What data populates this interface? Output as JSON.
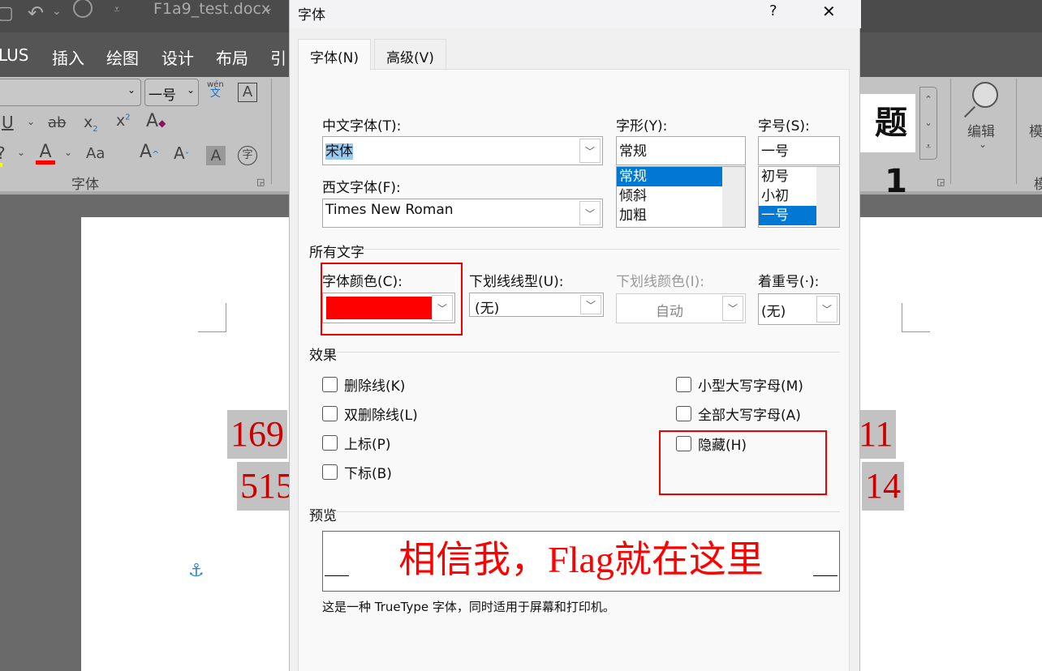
{
  "titlebar": {
    "filename": "F1a9_test.docx",
    "icons": [
      "save-icon",
      "undo-icon",
      "redo-icon",
      "customize-icon"
    ]
  },
  "menu": {
    "items": [
      "LUS",
      "插入",
      "绘图",
      "设计",
      "布局",
      "引"
    ]
  },
  "ribbon": {
    "font_size_value": "一号",
    "group_label": "字体",
    "style_preview": "题 1",
    "edit_label": "编辑",
    "partial_label": "模",
    "partial_label2": "模",
    "phonetic_top": "wén",
    "phonetic_bottom": "文",
    "char_border": "A",
    "circle_char": "字",
    "aa_label": "Aa"
  },
  "document": {
    "line1_left": "169",
    "line2_left": "515",
    "line1_right": "11",
    "line2_right": "14",
    "text_color": "#cc0000"
  },
  "dialog": {
    "title": "字体",
    "help": "?",
    "close": "✕",
    "tabs": [
      {
        "label": "字体(N)",
        "active": true
      },
      {
        "label": "高级(V)",
        "active": false
      }
    ],
    "chinese_font": {
      "label": "中文字体(T):",
      "value": "宋体"
    },
    "western_font": {
      "label": "西文字体(F):",
      "value": "Times New Roman"
    },
    "style": {
      "label": "字形(Y):",
      "value": "常规",
      "options": [
        "常规",
        "倾斜",
        "加粗"
      ],
      "selected": "常规"
    },
    "size": {
      "label": "字号(S):",
      "value": "一号",
      "options": [
        "初号",
        "小初",
        "一号"
      ],
      "selected": "一号"
    },
    "all_text": {
      "label": "所有文字",
      "font_color": {
        "label": "字体颜色(C):",
        "value": "#ff0000"
      },
      "underline_style": {
        "label": "下划线线型(U):",
        "value": "(无)"
      },
      "underline_color": {
        "label": "下划线颜色(I):",
        "value": "自动",
        "disabled": true
      },
      "emphasis": {
        "label": "着重号(·):",
        "value": "(无)"
      }
    },
    "effects": {
      "label": "效果",
      "left": [
        {
          "label": "删除线(K)",
          "checked": false
        },
        {
          "label": "双删除线(L)",
          "checked": false
        },
        {
          "label": "上标(P)",
          "checked": false
        },
        {
          "label": "下标(B)",
          "checked": false
        }
      ],
      "right": [
        {
          "label": "小型大写字母(M)",
          "checked": false
        },
        {
          "label": "全部大写字母(A)",
          "checked": false
        },
        {
          "label": "隐藏(H)",
          "checked": false
        }
      ]
    },
    "preview": {
      "label": "预览",
      "text": "相信我，Flag就在这里",
      "color": "#ff0000",
      "note": "这是一种 TrueType 字体，同时适用于屏幕和打印机。"
    }
  },
  "annotations": {
    "color": "#ee0000"
  }
}
